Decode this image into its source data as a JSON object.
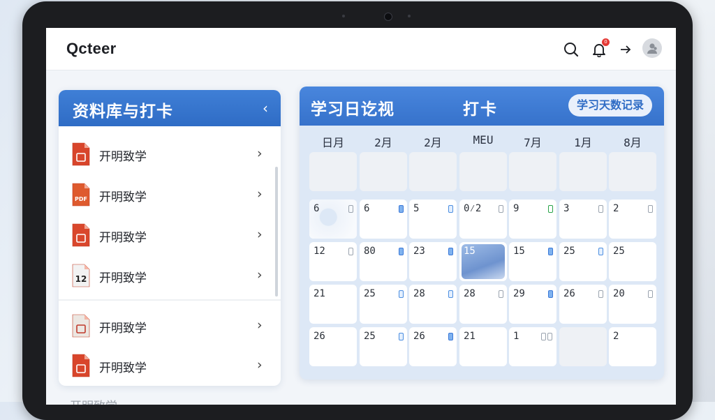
{
  "app": {
    "title": "Qcteer",
    "notification_count": "0"
  },
  "icons": {
    "search": "search-icon",
    "notifications": "bell-icon",
    "logout": "arrow-right-icon",
    "avatar": "user-avatar-icon",
    "collapse": "chevron-left-icon",
    "item_chevron": "chevron-right-icon"
  },
  "colors": {
    "accent": "#3672cb",
    "pdf_red": "#d8452b",
    "checked_blue": "#3a78d8",
    "checked_green": "#27a348"
  },
  "left_panel": {
    "title": "资料库与打卡",
    "collapse_glyph": "‹",
    "items": [
      {
        "label": "开明致学",
        "icon_text": ""
      },
      {
        "label": "开明致学",
        "icon_text": "PDF"
      },
      {
        "label": "开明致学",
        "icon_text": ""
      },
      {
        "label": "开明致学",
        "icon_text": "12"
      },
      {
        "label": "开明致学",
        "icon_text": ""
      },
      {
        "label": "开明致学",
        "icon_text": ""
      }
    ],
    "chevron_glyph": "›"
  },
  "calendar": {
    "title": "学习日讫视",
    "checkin_label": "打卡",
    "record_button": "学习天数记录",
    "day_headers": [
      "日月",
      "2月",
      "2月",
      "MEU",
      "7月",
      "1月",
      "8月"
    ],
    "rows": [
      [
        {
          "day": "",
          "marks": [],
          "empty": true
        },
        {
          "day": "",
          "marks": [],
          "empty": true
        },
        {
          "day": "",
          "marks": [],
          "empty": true
        },
        {
          "day": "",
          "marks": [],
          "empty": true
        },
        {
          "day": "",
          "marks": [],
          "empty": true
        },
        {
          "day": "",
          "marks": [],
          "empty": true
        },
        {
          "day": "",
          "marks": [],
          "empty": true
        }
      ],
      [
        {
          "day": "6",
          "marks": [
            "empty"
          ],
          "photo": true
        },
        {
          "day": "6",
          "marks": [
            "blue"
          ]
        },
        {
          "day": "5",
          "marks": [
            "light"
          ]
        },
        {
          "day": "0⁄2",
          "marks": [
            "empty"
          ]
        },
        {
          "day": "9",
          "marks": [
            "green"
          ]
        },
        {
          "day": "3",
          "marks": [
            "empty"
          ]
        },
        {
          "day": "2",
          "marks": [
            "empty"
          ]
        }
      ],
      [
        {
          "day": "12",
          "marks": [
            "empty"
          ]
        },
        {
          "day": "80",
          "marks": [
            "blue"
          ]
        },
        {
          "day": "23",
          "marks": [
            "blue"
          ]
        },
        {
          "day": "15",
          "marks": [],
          "photo": true
        },
        {
          "day": "15",
          "marks": [
            "blue"
          ]
        },
        {
          "day": "25",
          "marks": [
            "light"
          ]
        },
        {
          "day": "25",
          "marks": []
        }
      ],
      [
        {
          "day": "21",
          "marks": []
        },
        {
          "day": "25",
          "marks": [
            "light"
          ]
        },
        {
          "day": "28",
          "marks": [
            "light"
          ]
        },
        {
          "day": "28",
          "marks": [
            "empty"
          ]
        },
        {
          "day": "29",
          "marks": [
            "blue"
          ]
        },
        {
          "day": "26",
          "marks": [
            "empty"
          ]
        },
        {
          "day": "20",
          "marks": [
            "empty"
          ]
        }
      ],
      [
        {
          "day": "26",
          "marks": []
        },
        {
          "day": "25",
          "marks": [
            "light"
          ]
        },
        {
          "day": "26",
          "marks": [
            "blue"
          ]
        },
        {
          "day": "21",
          "marks": []
        },
        {
          "day": "1",
          "marks": [
            "empty",
            "empty"
          ]
        },
        {
          "day": "",
          "marks": [],
          "empty": true
        },
        {
          "day": "2",
          "marks": []
        }
      ]
    ]
  },
  "below_item": {
    "label": "开明致学"
  }
}
